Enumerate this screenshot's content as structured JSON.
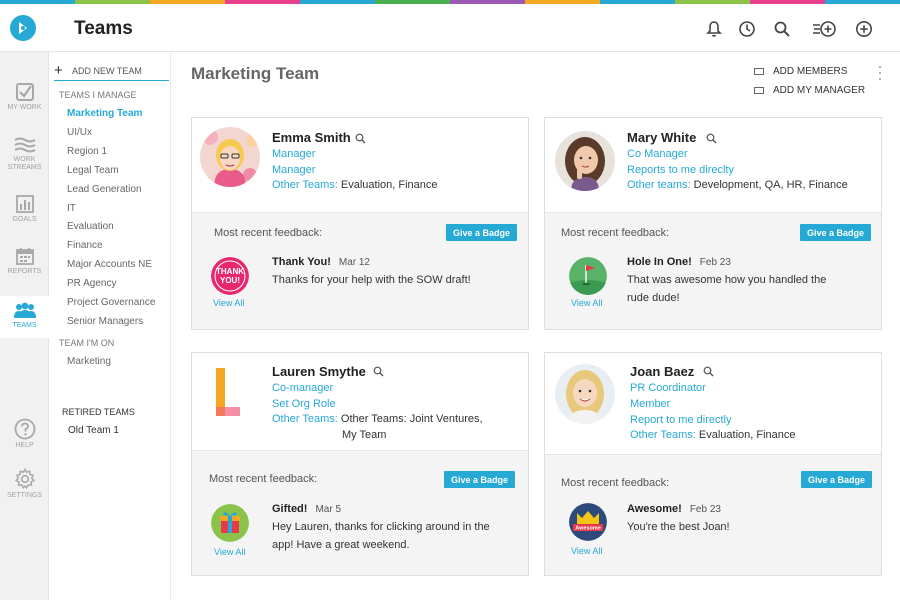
{
  "header": {
    "title": "Teams",
    "strip_colors": [
      "#27a9d6",
      "#8bc34a",
      "#f5a623",
      "#e83e8c",
      "#27a9d6",
      "#4caf50",
      "#9b59b6",
      "#f5a623",
      "#27a9d6",
      "#8bc34a",
      "#e83e8c",
      "#27a9d6"
    ]
  },
  "leftnav": {
    "items": [
      {
        "label": "MY WORK",
        "icon": "checkbox-icon"
      },
      {
        "label": "WORK STREAMS",
        "icon": "streams-icon"
      },
      {
        "label": "GOALS",
        "icon": "bar-chart-icon"
      },
      {
        "label": "REPORTS",
        "icon": "calendar-icon"
      },
      {
        "label": "TEAMS",
        "icon": "people-icon"
      },
      {
        "label": "HELP",
        "icon": "help-icon"
      },
      {
        "label": "SETTINGS",
        "icon": "gear-icon"
      }
    ]
  },
  "teamlist": {
    "add_label": "ADD NEW TEAM",
    "manage_header": "TEAMS I MANAGE",
    "manage_items": [
      "Marketing Team",
      "UI/Ux",
      "Region 1",
      "Legal Team",
      "Lead Generation",
      "IT",
      "Evaluation",
      "Finance",
      "Major Accounts NE",
      "PR Agency",
      "Project Governance",
      "Senior Managers"
    ],
    "on_header": "TEAM I'M ON",
    "on_items": [
      "Marketing"
    ],
    "retired_header": "RETIRED TEAMS",
    "retired_items": [
      "Old Team 1"
    ]
  },
  "main": {
    "title": "Marketing Team",
    "add_members": "ADD MEMBERS",
    "add_manager": "ADD MY MANAGER"
  },
  "common": {
    "feedback_label": "Most recent feedback:",
    "give_badge": "Give a Badge",
    "view_all": "View All"
  },
  "cards": [
    {
      "name": "Emma Smith",
      "line1": "Manager",
      "line2": "Manager",
      "teams_label": "Other Teams:",
      "teams_value": "Evaluation, Finance",
      "fb_title": "Thank You!",
      "fb_date": "Mar 12",
      "fb_line1": "Thanks for your help with the SOW draft!",
      "fb_line2": "",
      "badge_text_1": "THANK",
      "badge_text_2": "YOU!"
    },
    {
      "name": "Mary White",
      "line1": "Co Manager",
      "line2": "Reports to me direclty",
      "teams_label": "Other teams:",
      "teams_value": "Development, QA, HR, Finance",
      "fb_title": "Hole In One!",
      "fb_date": "Feb 23",
      "fb_line1": "That was awesome how you handled the",
      "fb_line2": "rude dude!"
    },
    {
      "name": "Lauren Smythe",
      "line1": "Co-manager",
      "line2": "Set Org Role",
      "teams_label": "Other Teams:",
      "teams_value": "Other Teams: Joint Ventures,",
      "teams_value_2": "My Team",
      "fb_title": "Gifted!",
      "fb_date": "Mar 5",
      "fb_line1": "Hey Lauren, thanks for clicking around in the",
      "fb_line2": "app! Have a great weekend."
    },
    {
      "name": "Joan Baez",
      "line1": "PR Coordinator",
      "line2": "Member",
      "line3": "Report to me directly",
      "teams_label": "Other Teams:",
      "teams_value": "Evaluation, Finance",
      "fb_title": "Awesome!",
      "fb_date": "Feb 23",
      "fb_line1": "You're the best Joan!",
      "fb_line2": "",
      "badge_text_1": "Awesome"
    }
  ],
  "colors": {
    "accent": "#27a9d6",
    "nav_bg": "#f1f1f1",
    "feedback_bg": "#f4f4f4"
  }
}
